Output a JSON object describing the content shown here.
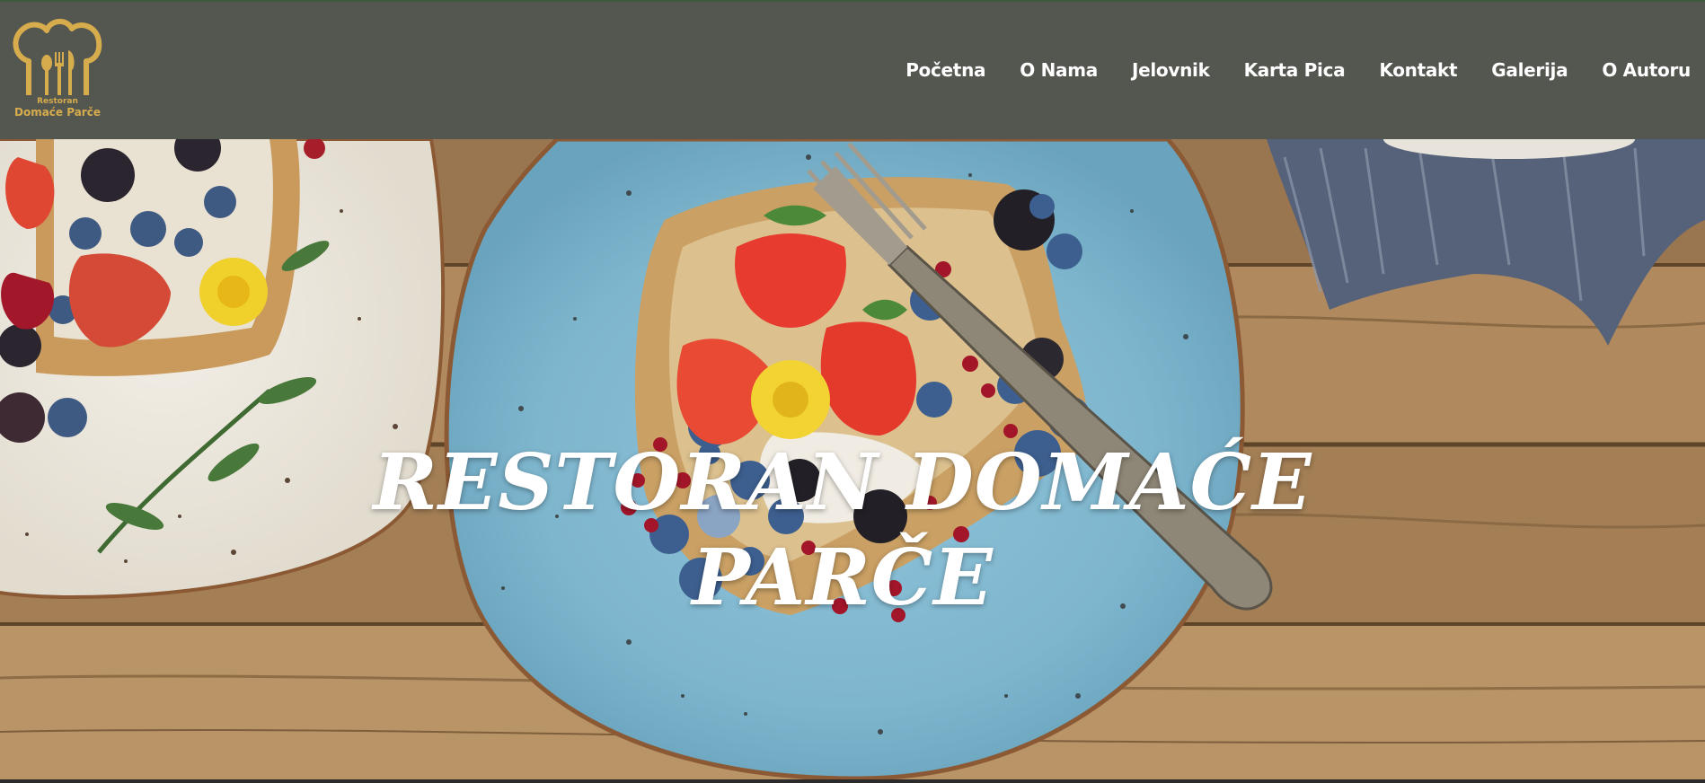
{
  "brand": {
    "logo_small": "Restoran",
    "logo_big": "Domaće Parče",
    "logo_color": "#d6ac4d"
  },
  "nav": {
    "items": [
      {
        "label": "Početna"
      },
      {
        "label": "O Nama"
      },
      {
        "label": "Jelovnik"
      },
      {
        "label": "Karta Pica"
      },
      {
        "label": "Kontakt"
      },
      {
        "label": "Galerija"
      },
      {
        "label": "O Autoru"
      }
    ]
  },
  "hero": {
    "title_line1": "RESTORAN DOMAĆE",
    "title_line2": "PARČE",
    "image_icon": "food-photo"
  },
  "colors": {
    "header_bg": "#545650",
    "text": "#ffffff"
  }
}
